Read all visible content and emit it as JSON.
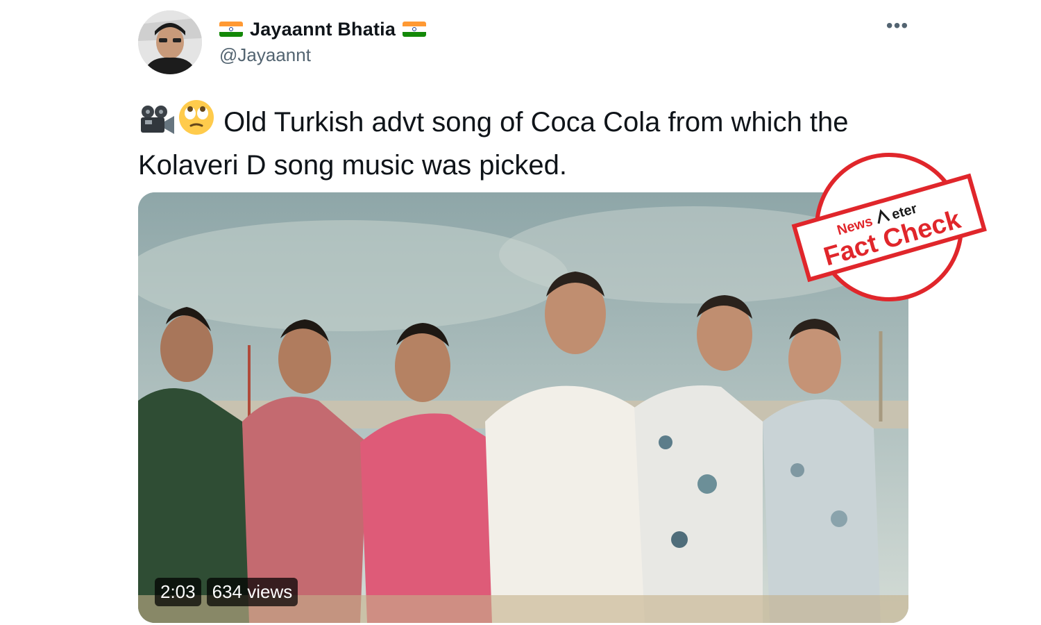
{
  "author": {
    "display_name": "Jayaannt Bhatia",
    "handle": "@Jayaannt",
    "flag_icon": "india-flag-icon"
  },
  "tweet": {
    "text": "Old Turkish advt  song of Coca Cola from which the Kolaveri D song music was picked.",
    "emojis": [
      "movie-camera-icon",
      "rolling-eyes-icon"
    ]
  },
  "video": {
    "duration": "2:03",
    "views": "634 views"
  },
  "stamp": {
    "brand_line_1": "News",
    "brand_line_2": "eter",
    "label": "Fact Check",
    "color": "#e0262b"
  },
  "colors": {
    "text": "#0f1419",
    "secondary": "#536471"
  }
}
